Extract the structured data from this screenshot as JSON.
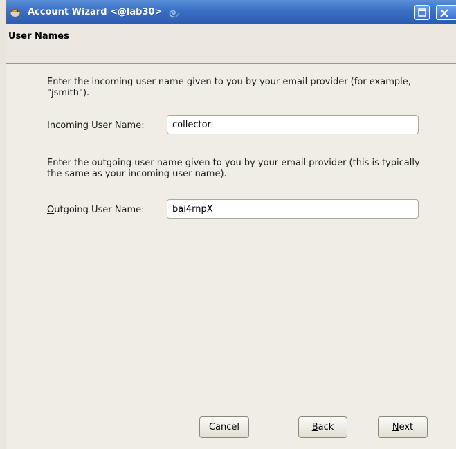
{
  "window": {
    "title": "Account Wizard <@lab30>"
  },
  "header": {
    "page_title": "User Names"
  },
  "incoming": {
    "instructions": "Enter the incoming user name given to you by your email provider (for example, \"jsmith\").",
    "label_mnemonic": "I",
    "label_rest": "ncoming User Name:",
    "value": "collector"
  },
  "outgoing": {
    "instructions": "Enter the outgoing user name given to you by your email provider (this is typically the same as your incoming user name).",
    "label_mnemonic": "O",
    "label_rest": "utgoing User Name:",
    "value": "bai4rnpX"
  },
  "buttons": {
    "cancel_label": "Cancel",
    "back_mnemonic": "B",
    "back_rest": "ack",
    "next_mnemonic": "N",
    "next_rest": "ext"
  },
  "icons": {
    "app": "thunderbird-icon",
    "title_decoration": "swirl-icon",
    "maximize": "maximize-icon",
    "close": "close-icon"
  },
  "colors": {
    "titlebar": "#3b6fc4",
    "dialog_bg": "#f0ede6",
    "field_border": "#b3a98a"
  }
}
